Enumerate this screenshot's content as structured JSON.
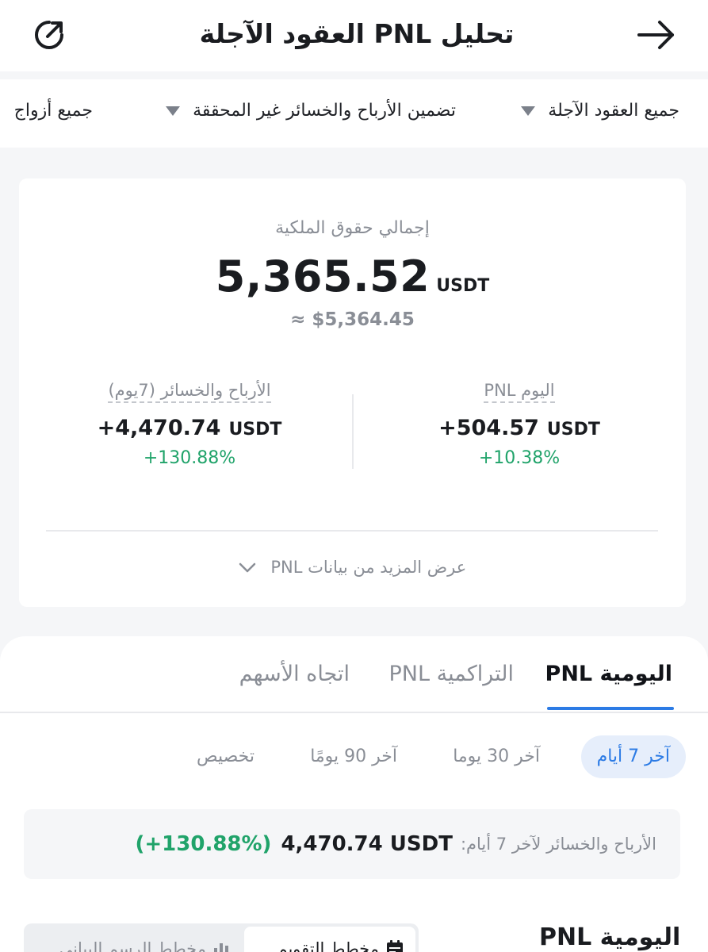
{
  "header": {
    "title": "تحليل PNL العقود الآجلة",
    "share_icon": "share-icon",
    "back_icon": "arrow-right-icon"
  },
  "filters": [
    {
      "label": "جميع العقود الآجلة"
    },
    {
      "label": "تضمين الأرباح والخسائر غير المحققة"
    },
    {
      "label": "جميع أزواج"
    }
  ],
  "summary": {
    "equity_label": "إجمالي حقوق الملكية",
    "equity_value": "5,365.52",
    "equity_unit": "USDT",
    "equity_usd": "≈ $5,364.45",
    "today": {
      "label": "اليوم PNL",
      "value": "+504.57",
      "unit": "USDT",
      "percent": "+10.38%"
    },
    "week": {
      "label": "الأرباح والخسائر (7يوم)",
      "value": "+4,470.74",
      "unit": "USDT",
      "percent": "+130.88%"
    },
    "show_more": "عرض المزيد من بيانات PNL"
  },
  "tabs": [
    {
      "label": "اليومية PNL",
      "active": true
    },
    {
      "label": "التراكمية PNL",
      "active": false
    },
    {
      "label": "اتجاه الأسهم",
      "active": false
    }
  ],
  "ranges": [
    {
      "label": "آخر 7 أيام",
      "active": true
    },
    {
      "label": "آخر 30 يوما",
      "active": false
    },
    {
      "label": "آخر 90 يومًا",
      "active": false
    },
    {
      "label": "تخصيص",
      "active": false
    }
  ],
  "period_summary": {
    "label": "الأرباح والخسائر لآخر 7 أيام:",
    "value": "4,470.74 USDT",
    "percent": "(+130.88%)"
  },
  "daily": {
    "title": "اليومية PNL",
    "calendar_option": "مخطط التقويم",
    "bar_option": "مخطط الرسم البياني"
  },
  "colors": {
    "positive": "#20a36a",
    "accent": "#2c7be5"
  }
}
